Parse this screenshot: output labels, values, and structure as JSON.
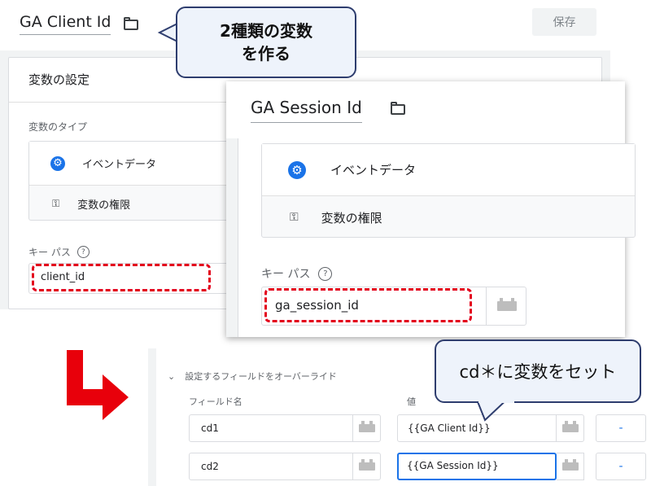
{
  "panel1": {
    "title": "GA Client Id",
    "save_label": "保存",
    "config_header": "変数の設定",
    "type_label": "変数のタイプ",
    "event_data_label": "イベントデータ",
    "permissions_label": "変数の権限",
    "key_path_label": "キー パス",
    "key_path_value": "client_id"
  },
  "panel2": {
    "title": "GA Session Id",
    "event_data_label": "イベントデータ",
    "permissions_label": "変数の権限",
    "key_path_label": "キー パス",
    "key_path_value": "ga_session_id"
  },
  "override": {
    "section_title": "設定するフィールドをオーバーライド",
    "field_name_header": "フィールド名",
    "value_header": "値",
    "rows": [
      {
        "field": "cd1",
        "value": "{{GA Client Id}}",
        "remove": "-"
      },
      {
        "field": "cd2",
        "value": "{{GA Session Id}}",
        "remove": "-"
      }
    ]
  },
  "callouts": {
    "top_line1": "2種類の変数",
    "top_line2": "を作る",
    "bottom": "cd＊に変数をセット"
  },
  "colors": {
    "accent": "#1a73e8",
    "highlight_red": "#e3001b",
    "callout_fill": "#eef3fb",
    "callout_border": "#2e3d6e"
  }
}
